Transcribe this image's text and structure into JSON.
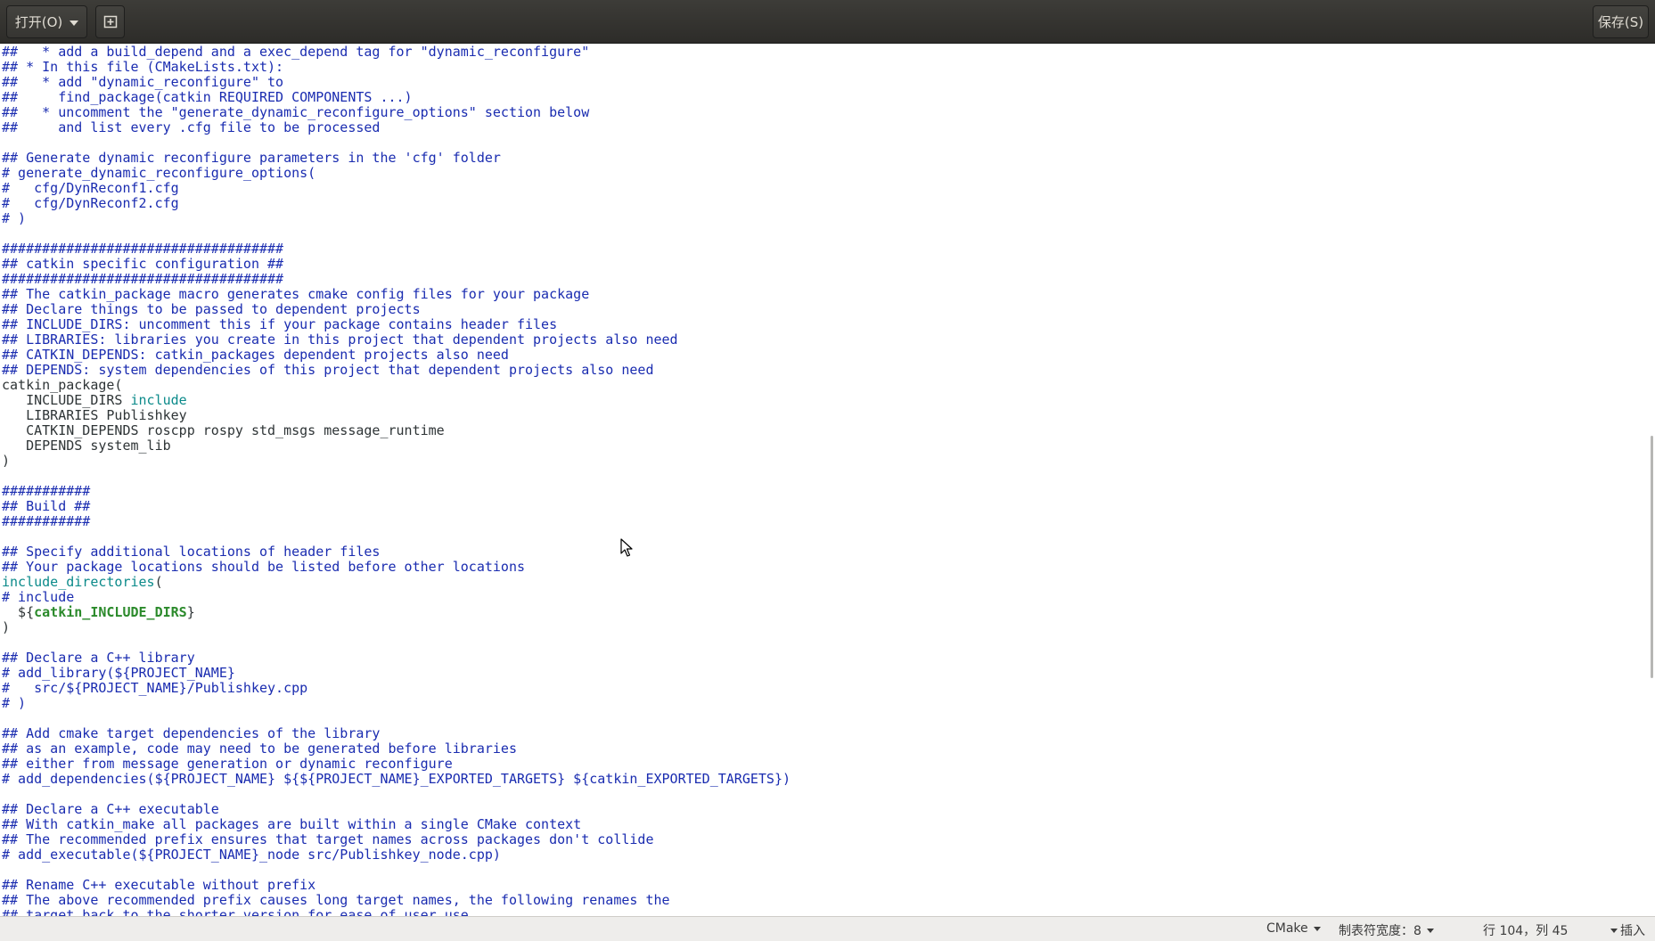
{
  "header": {
    "open_label": "打开(O)",
    "save_label": "保存(S)"
  },
  "code_lines": [
    [
      [
        "cm",
        "##   * add a build_depend and a exec_depend tag for \"dynamic_reconfigure\""
      ]
    ],
    [
      [
        "cm",
        "## * In this file (CMakeLists.txt):"
      ]
    ],
    [
      [
        "cm",
        "##   * add \"dynamic_reconfigure\" to"
      ]
    ],
    [
      [
        "cm",
        "##     find_package(catkin REQUIRED COMPONENTS ...)"
      ]
    ],
    [
      [
        "cm",
        "##   * uncomment the \"generate_dynamic_reconfigure_options\" section below"
      ]
    ],
    [
      [
        "cm",
        "##     and list every .cfg file to be processed"
      ]
    ],
    [
      [
        "txt",
        ""
      ]
    ],
    [
      [
        "cm",
        "## Generate dynamic reconfigure parameters in the 'cfg' folder"
      ]
    ],
    [
      [
        "cm",
        "# generate_dynamic_reconfigure_options("
      ]
    ],
    [
      [
        "cm",
        "#   cfg/DynReconf1.cfg"
      ]
    ],
    [
      [
        "cm",
        "#   cfg/DynReconf2.cfg"
      ]
    ],
    [
      [
        "cm",
        "# )"
      ]
    ],
    [
      [
        "txt",
        ""
      ]
    ],
    [
      [
        "cm",
        "###################################"
      ]
    ],
    [
      [
        "cm",
        "## catkin specific configuration ##"
      ]
    ],
    [
      [
        "cm",
        "###################################"
      ]
    ],
    [
      [
        "cm",
        "## The catkin_package macro generates cmake config files for your package"
      ]
    ],
    [
      [
        "cm",
        "## Declare things to be passed to dependent projects"
      ]
    ],
    [
      [
        "cm",
        "## INCLUDE_DIRS: uncomment this if your package contains header files"
      ]
    ],
    [
      [
        "cm",
        "## LIBRARIES: libraries you create in this project that dependent projects also need"
      ]
    ],
    [
      [
        "cm",
        "## CATKIN_DEPENDS: catkin_packages dependent projects also need"
      ]
    ],
    [
      [
        "cm",
        "## DEPENDS: system dependencies of this project that dependent projects also need"
      ]
    ],
    [
      [
        "txt",
        "catkin_package("
      ]
    ],
    [
      [
        "txt",
        "   INCLUDE_DIRS "
      ],
      [
        "kw",
        "include"
      ]
    ],
    [
      [
        "txt",
        "   LIBRARIES Publishkey"
      ]
    ],
    [
      [
        "txt",
        "   CATKIN_DEPENDS roscpp rospy std_msgs message_runtime"
      ]
    ],
    [
      [
        "txt",
        "   DEPENDS system_lib"
      ]
    ],
    [
      [
        "txt",
        ")"
      ]
    ],
    [
      [
        "txt",
        ""
      ]
    ],
    [
      [
        "cm",
        "###########"
      ]
    ],
    [
      [
        "cm",
        "## Build ##"
      ]
    ],
    [
      [
        "cm",
        "###########"
      ]
    ],
    [
      [
        "txt",
        ""
      ]
    ],
    [
      [
        "cm",
        "## Specify additional locations of header files"
      ]
    ],
    [
      [
        "cm",
        "## Your package locations should be listed before other locations"
      ]
    ],
    [
      [
        "kw",
        "include_directories"
      ],
      [
        "txt",
        "("
      ]
    ],
    [
      [
        "cm",
        "# include"
      ]
    ],
    [
      [
        "txt",
        "  ${"
      ],
      [
        "var",
        "catkin_INCLUDE_DIRS"
      ],
      [
        "txt",
        "}"
      ]
    ],
    [
      [
        "txt",
        ")"
      ]
    ],
    [
      [
        "txt",
        ""
      ]
    ],
    [
      [
        "cm",
        "## Declare a C++ library"
      ]
    ],
    [
      [
        "cm",
        "# add_library(${PROJECT_NAME}"
      ]
    ],
    [
      [
        "cm",
        "#   src/${PROJECT_NAME}/Publishkey.cpp"
      ]
    ],
    [
      [
        "cm",
        "# )"
      ]
    ],
    [
      [
        "txt",
        ""
      ]
    ],
    [
      [
        "cm",
        "## Add cmake target dependencies of the library"
      ]
    ],
    [
      [
        "cm",
        "## as an example, code may need to be generated before libraries"
      ]
    ],
    [
      [
        "cm",
        "## either from message generation or dynamic reconfigure"
      ]
    ],
    [
      [
        "cm",
        "# add_dependencies(${PROJECT_NAME} ${${PROJECT_NAME}_EXPORTED_TARGETS} ${catkin_EXPORTED_TARGETS})"
      ]
    ],
    [
      [
        "txt",
        ""
      ]
    ],
    [
      [
        "cm",
        "## Declare a C++ executable"
      ]
    ],
    [
      [
        "cm",
        "## With catkin_make all packages are built within a single CMake context"
      ]
    ],
    [
      [
        "cm",
        "## The recommended prefix ensures that target names across packages don't collide"
      ]
    ],
    [
      [
        "cm",
        "# add_executable(${PROJECT_NAME}_node src/Publishkey_node.cpp)"
      ]
    ],
    [
      [
        "txt",
        ""
      ]
    ],
    [
      [
        "cm",
        "## Rename C++ executable without prefix"
      ]
    ],
    [
      [
        "cm",
        "## The above recommended prefix causes long target names, the following renames the"
      ]
    ],
    [
      [
        "cm",
        "## target back to the shorter version for ease of user use"
      ]
    ]
  ],
  "statusbar": {
    "language": "CMake",
    "tab_width": "制表符宽度：8",
    "position": "行 104，列 45",
    "mode": "插入"
  }
}
